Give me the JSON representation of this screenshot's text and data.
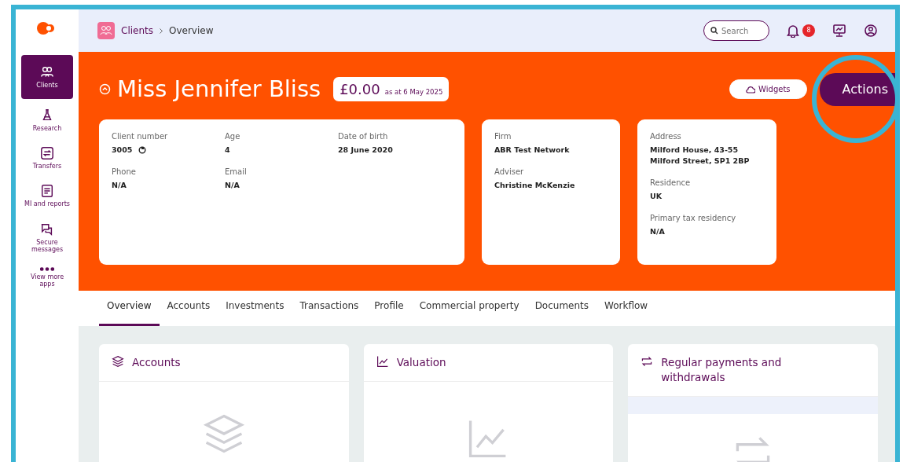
{
  "sidebar": {
    "items": [
      {
        "label": "Clients",
        "selected": true
      },
      {
        "label": "Research",
        "selected": false
      },
      {
        "label": "Transfers",
        "selected": false
      },
      {
        "label": "MI and reports",
        "selected": false
      },
      {
        "label": "Secure messages",
        "selected": false
      },
      {
        "label": "View more apps",
        "selected": false
      }
    ]
  },
  "breadcrumb": [
    "Clients",
    "Overview"
  ],
  "search": {
    "placeholder": "Search"
  },
  "notifications": {
    "count": "8"
  },
  "client": {
    "name": "Miss Jennifer Bliss",
    "balance": "£0.00",
    "balance_note": "as at 6 May 2025"
  },
  "header_buttons": {
    "widgets": "Widgets",
    "actions": "Actions"
  },
  "info_cards": [
    {
      "fields": [
        {
          "label": "Client number",
          "value": "3005",
          "copy": true
        },
        {
          "label": "Age",
          "value": "4"
        },
        {
          "label": "Date of birth",
          "value": "28 June 2020"
        },
        {
          "label": "Phone",
          "value": "N/A"
        },
        {
          "label": "Email",
          "value": "N/A"
        }
      ]
    },
    {
      "fields": [
        {
          "label": "Firm",
          "value": "ABR Test Network"
        },
        {
          "label": "Adviser",
          "value": "Christine McKenzie"
        }
      ]
    },
    {
      "fields": [
        {
          "label": "Address",
          "lines": [
            "Milford House, 43-55",
            "Milford Street, SP1 2BP"
          ]
        },
        {
          "label": "Residence",
          "value": "UK"
        },
        {
          "label": "Primary tax residency",
          "value": "N/A"
        }
      ]
    }
  ],
  "tabs": [
    {
      "label": "Overview",
      "selected": true
    },
    {
      "label": "Accounts",
      "selected": false
    },
    {
      "label": "Investments",
      "selected": false
    },
    {
      "label": "Transactions",
      "selected": false
    },
    {
      "label": "Profile",
      "selected": false
    },
    {
      "label": "Commercial property",
      "selected": false
    },
    {
      "label": "Documents",
      "selected": false
    },
    {
      "label": "Workflow",
      "selected": false
    }
  ],
  "widgets": [
    {
      "title": "Accounts"
    },
    {
      "title": "Valuation"
    },
    {
      "title": "Regular payments and withdrawals"
    }
  ]
}
